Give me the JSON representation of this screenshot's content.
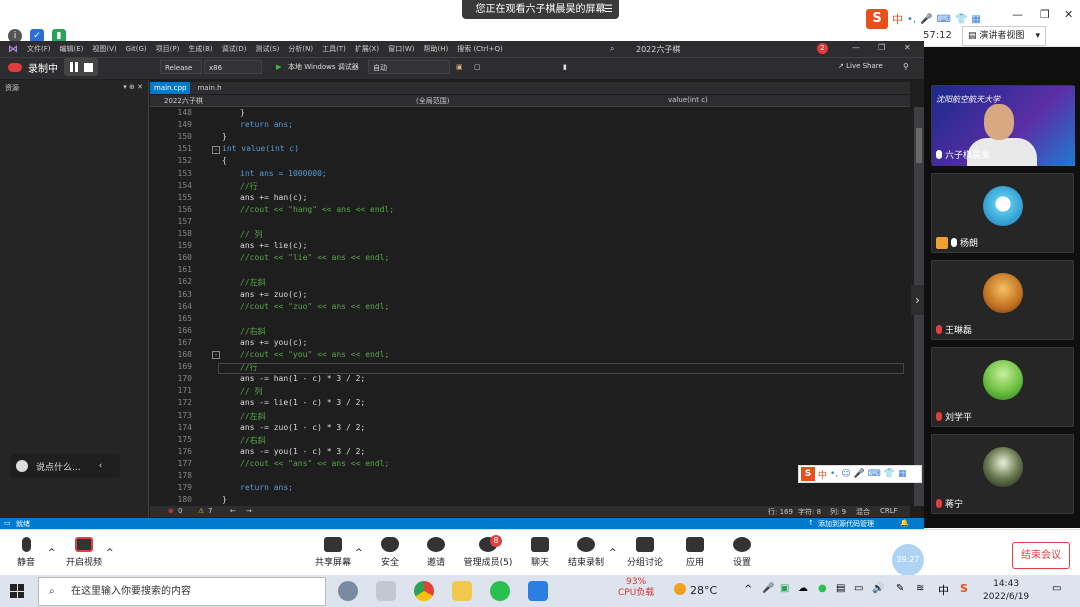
{
  "meeting": {
    "share_banner": "您正在观看六子棋晨昊的屏幕",
    "timer": "57:12",
    "speaker_view": "演讲者视图",
    "ime_label": "中",
    "participants": [
      {
        "name": "六子棋晨昊",
        "banner": "沈阳航空航天大学"
      },
      {
        "name": "杨朗"
      },
      {
        "name": "王琳磊"
      },
      {
        "name": "刘学平"
      },
      {
        "name": "蒋宁"
      }
    ],
    "chat_placeholder": "说点什么...",
    "recording": "录制中",
    "toolbar": {
      "mute": "静音",
      "video": "开启视频",
      "share": "共享屏幕",
      "security": "安全",
      "invite": "邀请",
      "members": "管理成员(5)",
      "members_badge": "8",
      "chat": "聊天",
      "end_record": "结束录制",
      "breakout": "分组讨论",
      "apps": "应用",
      "settings": "设置",
      "end_meeting": "结束会议",
      "ball_time": "39:27"
    }
  },
  "vs": {
    "menu": [
      "文件(F)",
      "编辑(E)",
      "视图(V)",
      "Git(G)",
      "项目(P)",
      "生成(B)",
      "调试(D)",
      "测试(S)",
      "分析(N)",
      "工具(T)",
      "扩展(X)",
      "窗口(W)",
      "帮助(H)",
      "搜索 (Ctrl+Q)"
    ],
    "title": "2022六子棋",
    "notif_count": "2",
    "config": "Release",
    "platform": "x86",
    "debugger": "本地 Windows 调试器",
    "auto": "自动",
    "live_share": "Live Share",
    "left_panel_title": "资源",
    "tabs": [
      "main.cpp",
      "main.h"
    ],
    "nav_project": "2022六子棋",
    "nav_scope": "(全局范围)",
    "nav_func": "value(int c)",
    "lines": [
      {
        "n": "148",
        "t": "}",
        "k": "tx"
      },
      {
        "n": "149",
        "t": "return ans;",
        "k": "kw"
      },
      {
        "n": "150",
        "t": "}",
        "k": "tx"
      },
      {
        "n": "151",
        "t": "int value(int c)",
        "k": "kw"
      },
      {
        "n": "152",
        "t": "{",
        "k": "tx"
      },
      {
        "n": "153",
        "t": "int ans = 1000000;",
        "k": "kw"
      },
      {
        "n": "154",
        "t": "//行",
        "k": "cm"
      },
      {
        "n": "155",
        "t": "ans += han(c);",
        "k": "tx"
      },
      {
        "n": "156",
        "t": "//cout << \"hang\" << ans << endl;",
        "k": "cm"
      },
      {
        "n": "157",
        "t": "",
        "k": "tx"
      },
      {
        "n": "158",
        "t": "// 列",
        "k": "cm"
      },
      {
        "n": "159",
        "t": "ans += lie(c);",
        "k": "tx"
      },
      {
        "n": "160",
        "t": "//cout << \"lie\" << ans << endl;",
        "k": "cm"
      },
      {
        "n": "161",
        "t": "",
        "k": "tx"
      },
      {
        "n": "162",
        "t": "//左斜",
        "k": "cm"
      },
      {
        "n": "163",
        "t": "ans += zuo(c);",
        "k": "tx"
      },
      {
        "n": "164",
        "t": "//cout << \"zuo\" << ans << endl;",
        "k": "cm"
      },
      {
        "n": "165",
        "t": "",
        "k": "tx"
      },
      {
        "n": "166",
        "t": "//右斜",
        "k": "cm"
      },
      {
        "n": "167",
        "t": "ans += you(c);",
        "k": "tx"
      },
      {
        "n": "168",
        "t": "//cout << \"you\" << ans << endl;",
        "k": "cm"
      },
      {
        "n": "169",
        "t": "//行",
        "k": "cm"
      },
      {
        "n": "170",
        "t": "ans -= han(1 - c) * 3 / 2;",
        "k": "tx"
      },
      {
        "n": "171",
        "t": "// 列",
        "k": "cm"
      },
      {
        "n": "172",
        "t": "ans -= lie(1 - c) * 3 / 2;",
        "k": "tx"
      },
      {
        "n": "173",
        "t": "//左斜",
        "k": "cm"
      },
      {
        "n": "174",
        "t": "ans -= zuo(1 - c) * 3 / 2;",
        "k": "tx"
      },
      {
        "n": "175",
        "t": "//右斜",
        "k": "cm"
      },
      {
        "n": "176",
        "t": "ans -= you(1 - c) * 3 / 2;",
        "k": "tx"
      },
      {
        "n": "177",
        "t": "//cout << \"ans\" << ans << endl;",
        "k": "cm"
      },
      {
        "n": "178",
        "t": "",
        "k": "tx"
      },
      {
        "n": "179",
        "t": "return ans;",
        "k": "kw"
      },
      {
        "n": "180",
        "t": "}",
        "k": "tx"
      }
    ],
    "errors": "0",
    "warnings": "7",
    "row": "行: 169",
    "char": "字符: 8",
    "col": "列: 9",
    "mixed": "混合",
    "eol": "CRLF",
    "status_ready": "就绪",
    "add_source": "添加到源代码管理"
  },
  "taskbar": {
    "search_placeholder": "在这里输入你要搜索的内容",
    "cpu_percent": "93%",
    "cpu_label": "CPU负载",
    "temp": "28°C",
    "ime": "中",
    "time": "14:43",
    "date": "2022/6/19"
  }
}
